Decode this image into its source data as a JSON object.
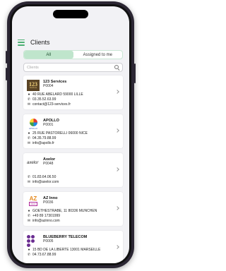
{
  "status": {
    "time": ""
  },
  "header": {
    "title": "Clients",
    "menu_icon": "menu-icon"
  },
  "tabs": [
    {
      "label": "All",
      "active": true
    },
    {
      "label": "Assigned to me",
      "active": false
    }
  ],
  "search": {
    "placeholder": "Clients"
  },
  "clients": [
    {
      "name": "123 Services",
      "code": "P0004",
      "logo": "123-services-logo",
      "address": "40 RUE ABELARD 59000 LILLE",
      "phone": "03.35.52.63.99",
      "email": "contact@123-services.fr"
    },
    {
      "name": "APOLLO",
      "code": "P0001",
      "logo": "apollo-logo",
      "address": "25 RUE PASTORELLI 06000 NICE",
      "phone": "04.35.79.88.99",
      "email": "info@apollo.fr"
    },
    {
      "name": "Axelor",
      "code": "P0048",
      "logo": "axelor-logo",
      "address": "",
      "phone": "01.83.64.06.50",
      "email": "info@axelor.com"
    },
    {
      "name": "AZ Inno",
      "code": "P0036",
      "logo": "az-inno-logo",
      "address": "GOETHESTRABE, 11 80336 MUNCHEN",
      "phone": "+49 89 17301999",
      "email": "info@azinno.com"
    },
    {
      "name": "BLUEBERRY TELECOM",
      "code": "P0005",
      "logo": "blueberry-telecom-logo",
      "address": "15 BD DE LA LIBERTE 13001 MARSEILLE",
      "phone": "04.73.67.88.99",
      "email": ""
    }
  ],
  "logo_text": {
    "l123": "123",
    "l123_sub": "Services",
    "apollo": "APOLLO",
    "axelor": "axelor",
    "az": "AZ",
    "az_sub": "INNO"
  },
  "colors": {
    "accent": "#4caf72",
    "active_tab": "#bfe5cc",
    "background": "#f2f2f5"
  }
}
